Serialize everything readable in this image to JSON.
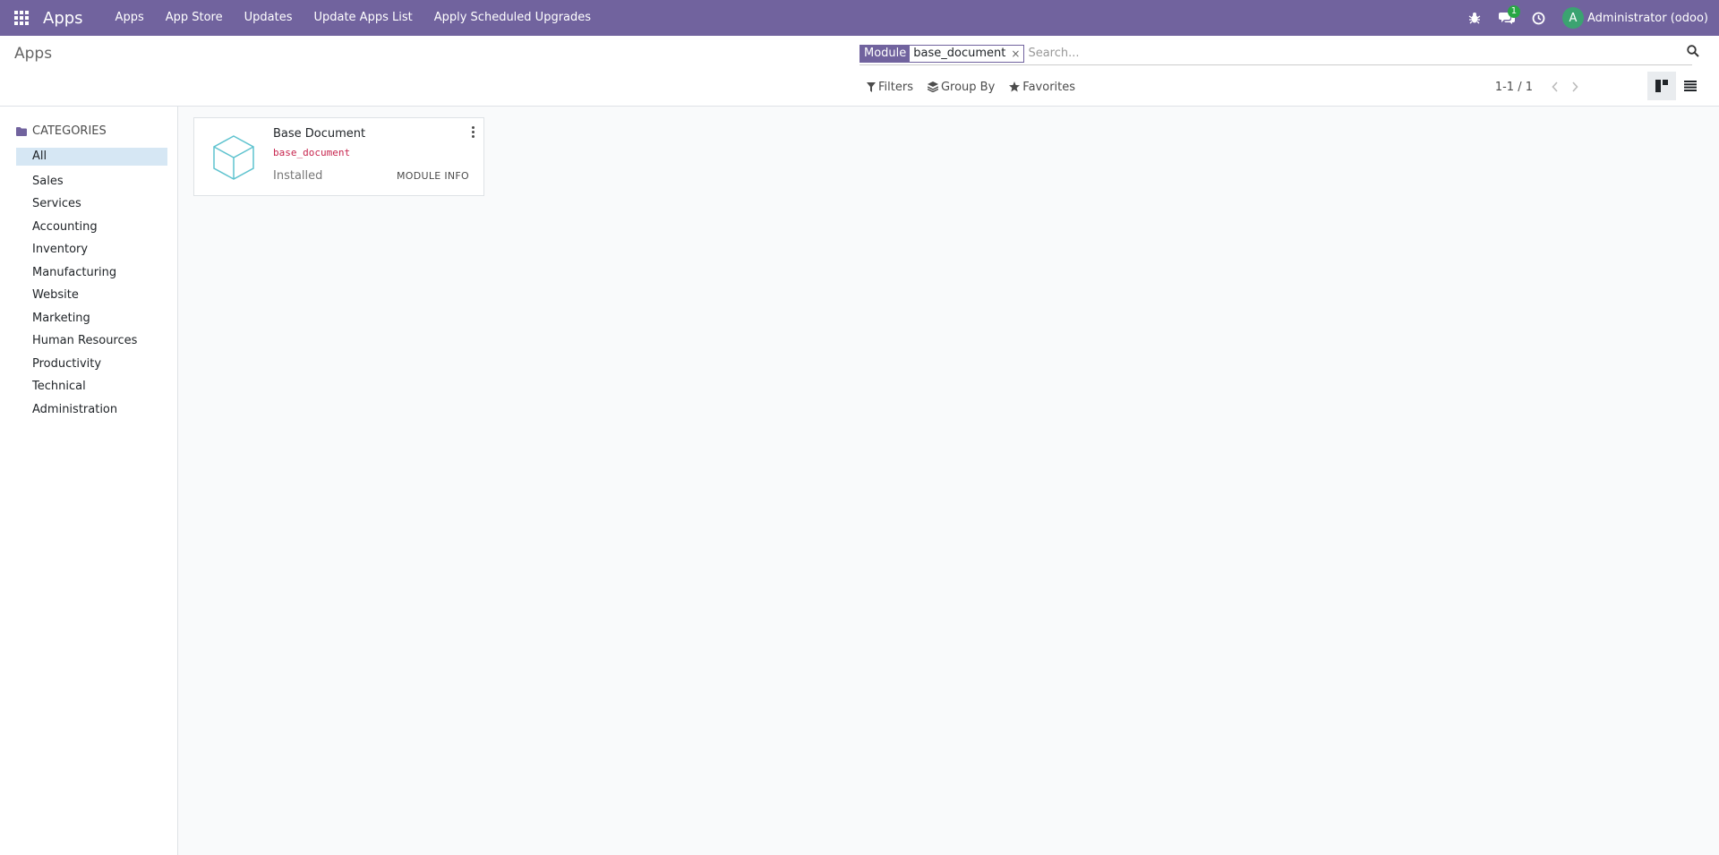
{
  "navbar": {
    "brand": "Apps",
    "menu_items": [
      "Apps",
      "App Store",
      "Updates",
      "Update Apps List",
      "Apply Scheduled Upgrades"
    ],
    "messages_badge": "1",
    "user_initial": "A",
    "user_name": "Administrator (odoo)",
    "color": "#71639e"
  },
  "control_panel": {
    "breadcrumb": "Apps",
    "search": {
      "facet_label": "Module",
      "facet_value": "base_document",
      "facet_remove": "×",
      "placeholder": "Search..."
    },
    "filters_label": "Filters",
    "group_by_label": "Group By",
    "favorites_label": "Favorites",
    "pager": "1-1 / 1"
  },
  "sidebar": {
    "header": "CATEGORIES",
    "categories": [
      "All",
      "Sales",
      "Services",
      "Accounting",
      "Inventory",
      "Manufacturing",
      "Website",
      "Marketing",
      "Human Resources",
      "Productivity",
      "Technical",
      "Administration"
    ],
    "active": "All"
  },
  "records": [
    {
      "title": "Base Document",
      "technical_name": "base_document",
      "status": "Installed",
      "action_label": "MODULE INFO"
    }
  ]
}
